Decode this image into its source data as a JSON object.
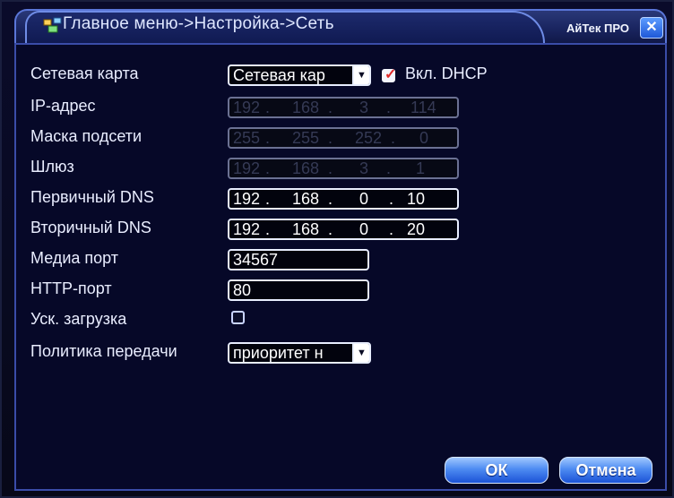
{
  "title": "Главное меню->Настройка->Сеть",
  "brand": "АйТек ПРО",
  "form": {
    "network_card_label": "Сетевая карта",
    "network_card_value": "Сетевая кар",
    "dhcp_label": "Вкл. DHCP",
    "dhcp_checked": true,
    "ip_label": "IP-адрес",
    "ip": [
      "192",
      "168",
      "3",
      "114"
    ],
    "mask_label": "Маска подсети",
    "mask": [
      "255",
      "255",
      "252",
      "0"
    ],
    "gateway_label": "Шлюз",
    "gateway": [
      "192",
      "168",
      "3",
      "1"
    ],
    "dns1_label": "Первичный DNS",
    "dns1": [
      "192",
      "168",
      "0",
      "10"
    ],
    "dns2_label": "Вторичный DNS",
    "dns2": [
      "192",
      "168",
      "0",
      "20"
    ],
    "media_port_label": "Медиа порт",
    "media_port_value": "34567",
    "http_port_label": "HTTP-порт",
    "http_port_value": "80",
    "fast_load_label": "Уск. загрузка",
    "fast_load_checked": false,
    "transfer_policy_label": "Политика передачи",
    "transfer_policy_value": "приоритет н"
  },
  "buttons": {
    "ok": "ОК",
    "cancel": "Отмена"
  },
  "icons": {
    "title": "network-icon",
    "close": "close-icon",
    "dropdown": "chevron-down-icon",
    "check": "checkmark-icon"
  },
  "colors": {
    "accent_blue": "#1e58d8",
    "panel_bg": "#060828",
    "check_red": "#e02a2a"
  }
}
